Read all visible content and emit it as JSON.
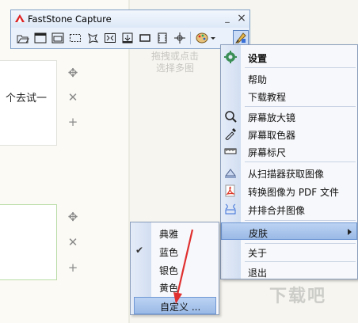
{
  "background": {
    "card1_text": "个去试一",
    "watermark_text": "拖拽或点击\n选择多图",
    "watermark_logo": "下载吧",
    "controls": [
      "✥",
      "✕",
      "+"
    ]
  },
  "app": {
    "title": "FastStone Capture",
    "minimize": "_",
    "close": "×"
  },
  "toolbar_icons": [
    "open-file-icon",
    "capture-active-window-icon",
    "capture-window-object-icon",
    "capture-rectangle-icon",
    "capture-freehand-icon",
    "capture-fullscreen-icon",
    "capture-scrolling-icon",
    "capture-fixed-region-icon",
    "screen-recorder-icon",
    "crosshair-icon",
    "output-palette-icon",
    "settings-menu-icon"
  ],
  "menu": {
    "settings": "设置",
    "help": "帮助",
    "tutorial": "下载教程",
    "magnifier": "屏幕放大镜",
    "color_picker": "屏幕取色器",
    "ruler": "屏幕标尺",
    "scanner": "从扫描器获取图像",
    "to_pdf": "转换图像为 PDF 文件",
    "merge": "并排合并图像",
    "skin": "皮肤",
    "about": "关于",
    "exit": "退出"
  },
  "skin_submenu": {
    "items": [
      "典雅",
      "蓝色",
      "银色",
      "黄色"
    ],
    "selected": "蓝色",
    "custom": "自定义 ..."
  },
  "colors": {
    "menu_highlight": "#9ab9e6",
    "annotation_arrow": "#e03030"
  }
}
